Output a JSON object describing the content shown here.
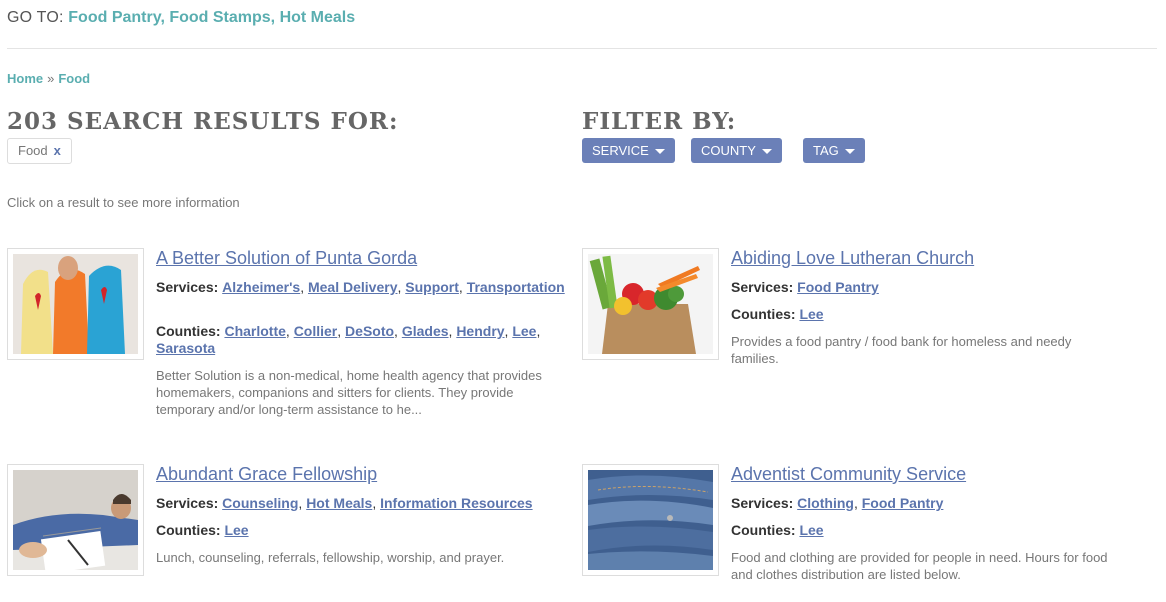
{
  "goto": {
    "label": "GO TO: ",
    "links": [
      "Food Pantry",
      "Food Stamps",
      "Hot Meals"
    ],
    "sep": ", "
  },
  "breadcrumb": {
    "home": "Home",
    "sep": "»",
    "current": "Food"
  },
  "results_heading": "203 SEARCH RESULTS FOR:",
  "search_chip": {
    "label": "Food",
    "remove": "x"
  },
  "filter": {
    "heading": "FILTER BY:",
    "buttons": [
      "SERVICE",
      "COUNTY",
      "TAG"
    ]
  },
  "hint": "Click on a result to see more information",
  "results": [
    {
      "title": "A Better Solution of Punta Gorda",
      "services_label": "Services:",
      "services": [
        "Alzheimer's",
        "Meal Delivery",
        "Support",
        "Transportation"
      ],
      "counties_label": "Counties:",
      "counties": [
        "Charlotte",
        "Collier",
        "DeSoto",
        "Glades",
        "Hendry",
        "Lee",
        "Sarasota"
      ],
      "description": "Better Solution is a non-medical, home health agency that provides homemakers, companions and sitters for clients. They provide temporary and/or long-term assistance to he...",
      "image_icon": "ribbon-people-photo"
    },
    {
      "title": "Abiding Love Lutheran Church",
      "services_label": "Services:",
      "services": [
        "Food Pantry"
      ],
      "counties_label": "Counties:",
      "counties": [
        "Lee"
      ],
      "description": "Provides a food pantry / food bank for homeless and needy families.",
      "image_icon": "grocery-bag-photo"
    },
    {
      "title": "Abundant Grace Fellowship",
      "services_label": "Services:",
      "services": [
        "Counseling",
        "Hot Meals",
        "Information Resources"
      ],
      "counties_label": "Counties:",
      "counties": [
        "Lee"
      ],
      "description": "Lunch, counseling, referrals, fellowship, worship, and prayer.",
      "image_icon": "counseling-photo"
    },
    {
      "title": "Adventist Community Service",
      "services_label": "Services:",
      "services": [
        "Clothing",
        "Food Pantry"
      ],
      "counties_label": "Counties:",
      "counties": [
        "Lee"
      ],
      "description": "Food and clothing are provided for people in need. Hours for food and clothes distribution are listed below.",
      "image_icon": "jeans-photo"
    }
  ],
  "colors": {
    "teal": "#5aaeb0",
    "link_blue": "#5b74ad",
    "filter_btn": "#6b80b8"
  }
}
